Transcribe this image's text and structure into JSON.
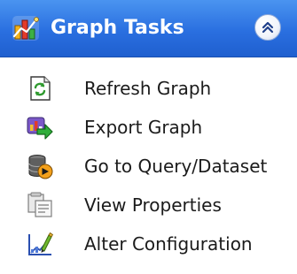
{
  "panel": {
    "title": "Graph Tasks",
    "header_icon": "graph-tasks-icon",
    "collapse_icon": "chevron-double-up-icon",
    "colors": {
      "header_top": "#4a94f0",
      "header_bottom": "#1f5fcf",
      "header_text": "#ffffff",
      "item_text": "#1b1b1b"
    }
  },
  "items": [
    {
      "label": "Refresh Graph",
      "icon": "refresh-icon"
    },
    {
      "label": "Export Graph",
      "icon": "export-icon"
    },
    {
      "label": "Go to Query/Dataset",
      "icon": "query-dataset-icon"
    },
    {
      "label": "View Properties",
      "icon": "properties-icon"
    },
    {
      "label": "Alter Configuration",
      "icon": "configuration-icon"
    }
  ]
}
